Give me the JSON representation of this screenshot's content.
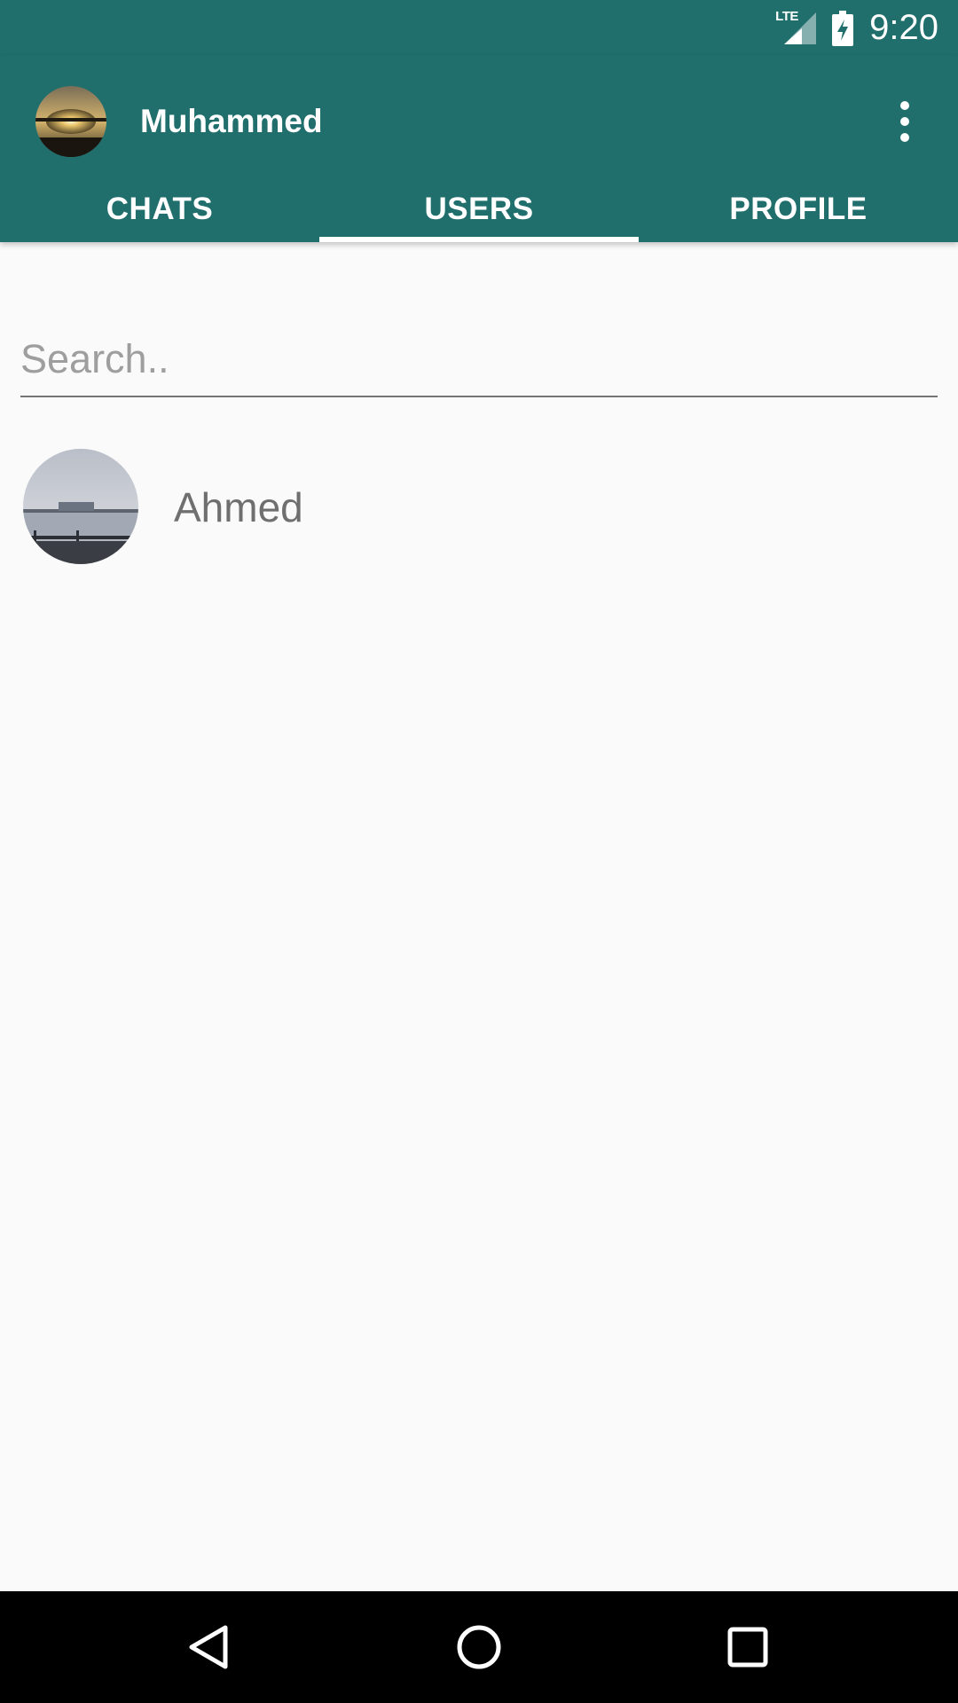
{
  "status_bar": {
    "network": "LTE",
    "time": "9:20"
  },
  "header": {
    "user_name": "Muhammed"
  },
  "tabs": [
    {
      "label": "CHATS",
      "selected": false
    },
    {
      "label": "USERS",
      "selected": true
    },
    {
      "label": "PROFILE",
      "selected": false
    }
  ],
  "search": {
    "placeholder": "Search..",
    "value": ""
  },
  "users": [
    {
      "name": "Ahmed"
    }
  ],
  "colors": {
    "primary": "#216f6d",
    "background": "#fafafa",
    "nav_bar": "#000000"
  },
  "icons": {
    "status": [
      "lte-signal-icon",
      "battery-charging-icon"
    ],
    "toolbar": [
      "more-vert-icon"
    ],
    "navigation": [
      "back-icon",
      "home-icon",
      "recents-icon"
    ]
  }
}
